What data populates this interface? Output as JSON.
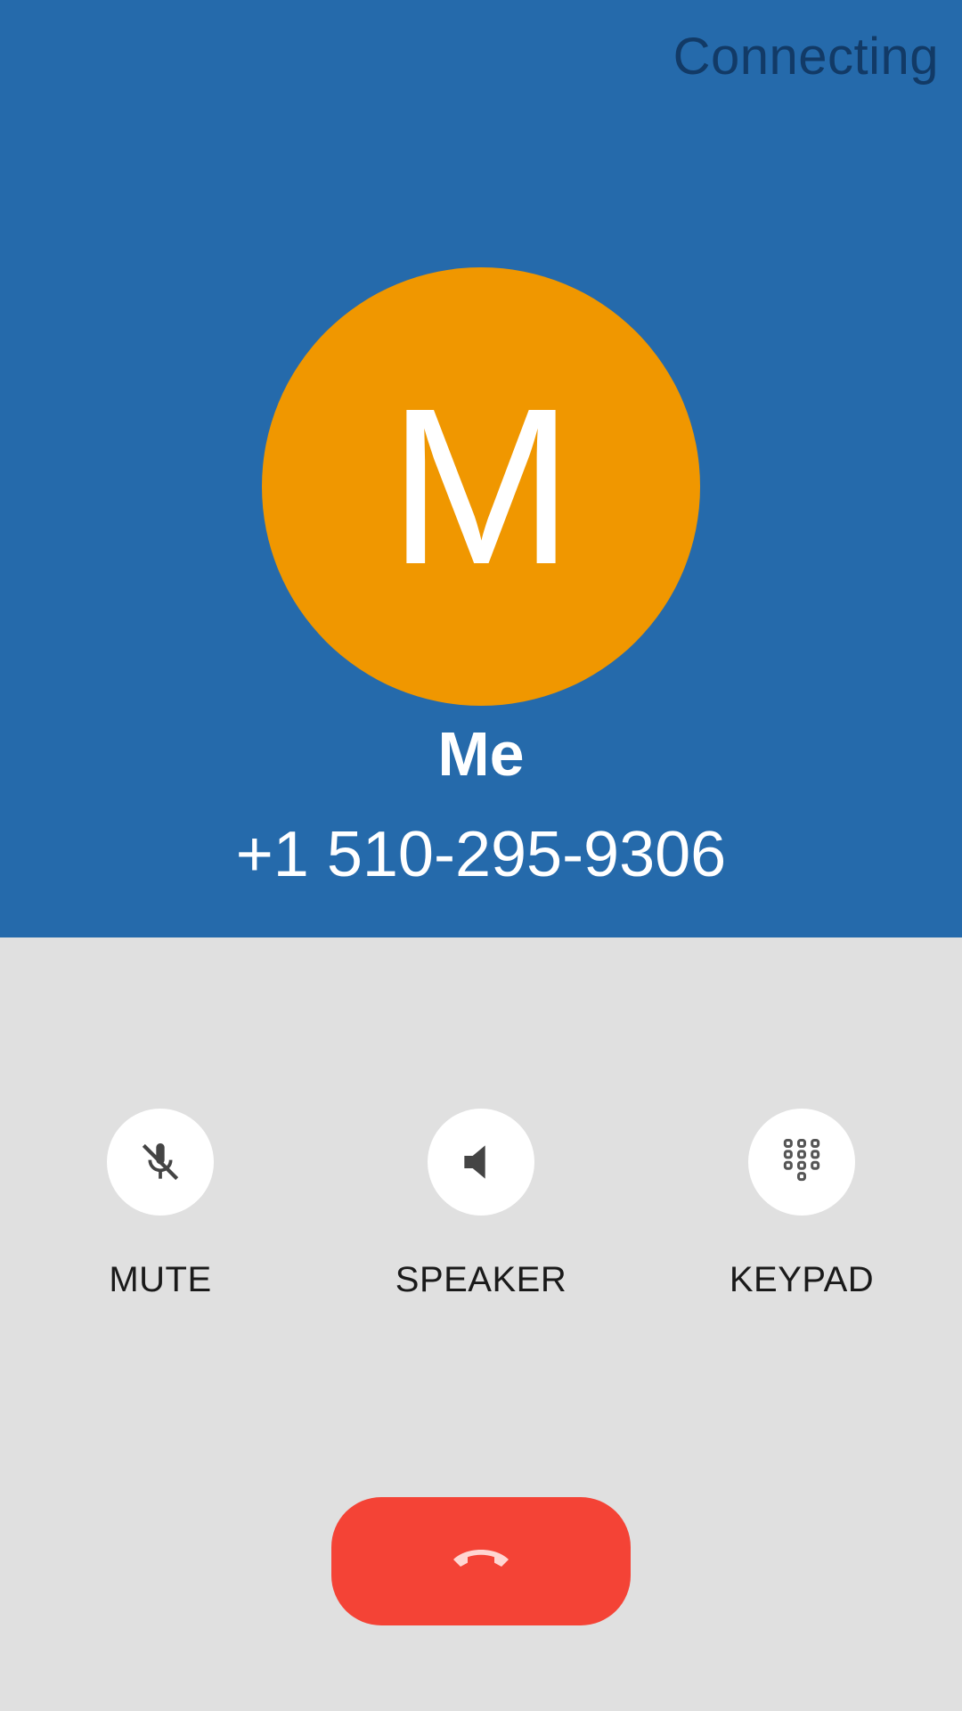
{
  "call": {
    "status": "Connecting",
    "avatar_letter": "M",
    "contact_name": "Me",
    "phone_number": "+1 510-295-9306"
  },
  "actions": {
    "mute_label": "MUTE",
    "speaker_label": "SPEAKER",
    "keypad_label": "KEYPAD"
  },
  "icons": {
    "mute": "mic-off-icon",
    "speaker": "speaker-icon",
    "keypad": "dialpad-icon",
    "end_call": "call-end-icon"
  },
  "colors": {
    "header_bg": "#256aab",
    "avatar_bg": "#f09700",
    "end_call_bg": "#f44336",
    "body_bg": "#e0e0e0"
  }
}
